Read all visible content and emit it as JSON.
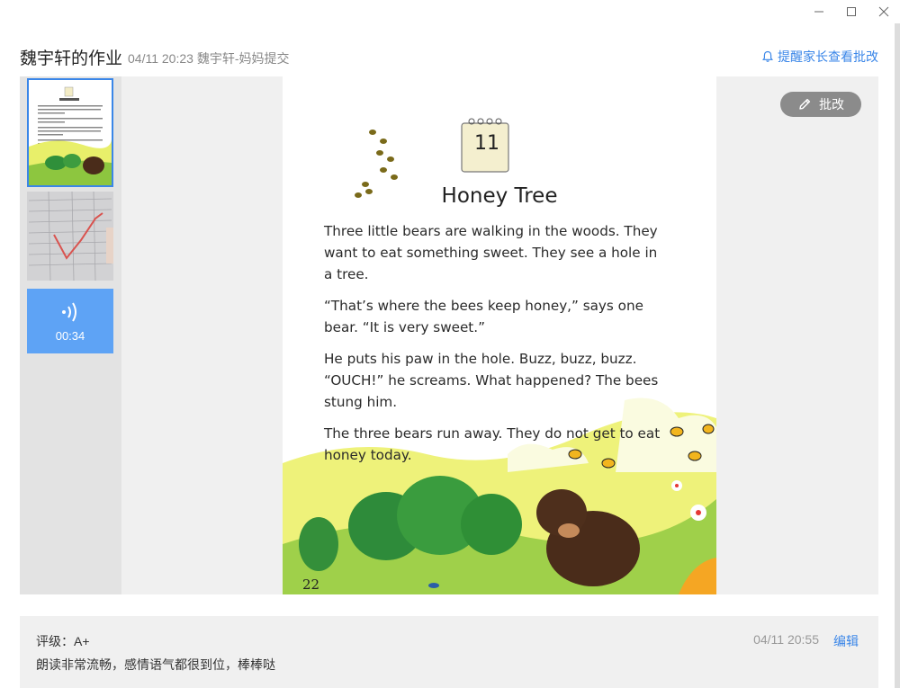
{
  "window": {
    "minimize_icon": "minimize-icon",
    "maximize_icon": "maximize-icon",
    "close_icon": "close-icon"
  },
  "header": {
    "title": "魏宇轩的作业",
    "subtitle": "04/11 20:23 魏宇轩-妈妈提交",
    "remind_label": "提醒家长查看批改",
    "remind_icon": "bell-icon"
  },
  "thumbnails": {
    "audio_duration": "00:34",
    "audio_icon": "sound-wave-icon"
  },
  "page": {
    "calendar_number": "11",
    "title": "Honey Tree",
    "paragraphs": [
      "Three little bears are walking in the woods. They want to eat something sweet. They see a hole in a tree.",
      "“That’s where the bees keep honey,” says one bear. “It is very sweet.”",
      "He puts his paw in the hole. Buzz, buzz, buzz. “OUCH!” he screams. What happened? The bees stung him.",
      "The three bears run away. They do not get to eat honey today."
    ],
    "page_number": "22"
  },
  "mark_button": {
    "label": "批改",
    "icon": "pencil-icon"
  },
  "review": {
    "grade_label": "评级：A+",
    "comment": "朗读非常流畅，感情语气都很到位，棒棒哒",
    "time": "04/11 20:55",
    "edit_label": "编辑"
  },
  "colors": {
    "accent": "#3a86e8",
    "audio_tile": "#5ea3f5",
    "panel_bg": "#f0f0f0",
    "mark_button_bg": "#8b8b8b"
  }
}
